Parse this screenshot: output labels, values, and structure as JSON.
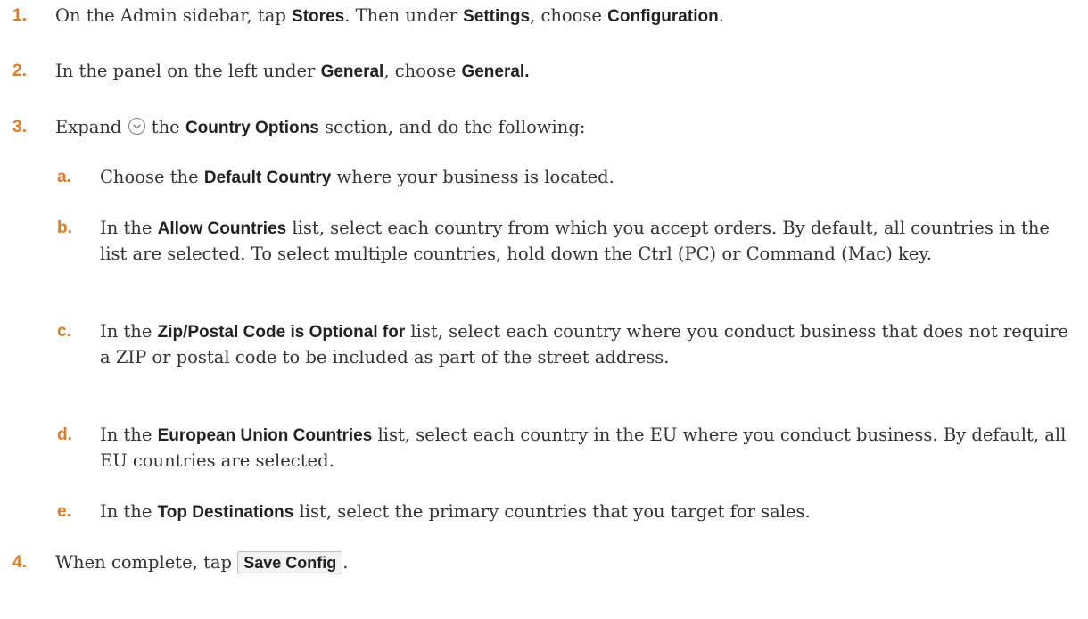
{
  "steps": [
    {
      "num": "1.",
      "parts": [
        {
          "t": "On the Admin sidebar, tap "
        },
        {
          "t": "Stores",
          "b": true
        },
        {
          "t": ". Then under "
        },
        {
          "t": "Settings",
          "b": true
        },
        {
          "t": ", choose "
        },
        {
          "t": "Configuration",
          "b": true
        },
        {
          "t": "."
        }
      ]
    },
    {
      "num": "2.",
      "parts": [
        {
          "t": "In the panel on the left under "
        },
        {
          "t": "General",
          "b": true
        },
        {
          "t": ", choose "
        },
        {
          "t": "General.",
          "b": true
        }
      ]
    },
    {
      "num": "3.",
      "parts": [
        {
          "t": "Expand "
        },
        {
          "icon": "expand-circle-chevron-icon"
        },
        {
          "t": " the "
        },
        {
          "t": "Country Options",
          "b": true
        },
        {
          "t": " section, and do the following:"
        }
      ],
      "sub": [
        {
          "num": "a.",
          "parts": [
            {
              "t": "Choose the "
            },
            {
              "t": "Default Country",
              "b": true
            },
            {
              "t": " where your business is located."
            }
          ]
        },
        {
          "num": "b.",
          "parts": [
            {
              "t": "In the "
            },
            {
              "t": "Allow Countries",
              "b": true
            },
            {
              "t": " list, select each country from which you accept orders. By default, all countries in the list are selected. To select multiple countries, hold down the Ctrl (PC) or Command (Mac) key."
            }
          ]
        },
        {
          "num": "c.",
          "parts": [
            {
              "t": "In the "
            },
            {
              "t": "Zip/Postal Code is Optional for",
              "b": true
            },
            {
              "t": " list, select each country where you conduct business that does not require a ZIP or postal code to be included as part of the street address."
            }
          ]
        },
        {
          "num": "d.",
          "parts": [
            {
              "t": "In the "
            },
            {
              "t": "European Union Countries",
              "b": true
            },
            {
              "t": " list, select each country in the EU where you conduct business. By default, all EU countries are selected."
            }
          ]
        },
        {
          "num": "e.",
          "parts": [
            {
              "t": "In the "
            },
            {
              "t": "Top Destinations",
              "b": true
            },
            {
              "t": " list, select the primary countries that you target for sales."
            }
          ]
        }
      ]
    },
    {
      "num": "4.",
      "parts": [
        {
          "t": "When complete, tap "
        },
        {
          "button": "Save Config"
        },
        {
          "t": "."
        }
      ]
    }
  ],
  "colors": {
    "number": "#e07b21",
    "text": "#333333",
    "bold": "#222222"
  }
}
